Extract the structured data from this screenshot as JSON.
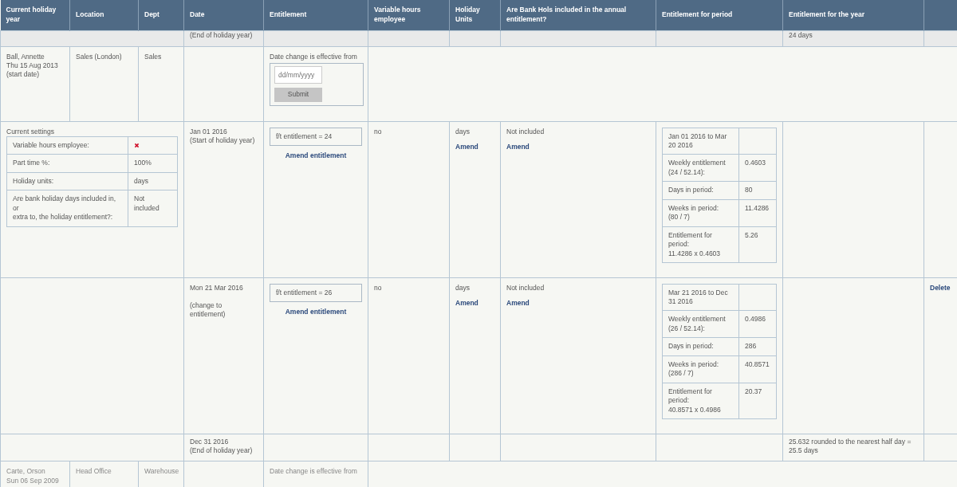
{
  "columns": [
    "Current holiday year",
    "Location",
    "Dept",
    "Date",
    "Entitlement",
    "Variable hours employee",
    "Holiday Units",
    "Are Bank Hols included in the annual entitlement?",
    "Entitlement for period",
    "Entitlement for the year"
  ],
  "rows": [
    {
      "kind": "year_end",
      "note": "(End of holiday year)",
      "year_total": "24 days"
    },
    {
      "kind": "employee",
      "name": "Ball, Annette",
      "start": "Thu 15 Aug 2013",
      "start_note": "(start date)",
      "location": "Sales (London)",
      "dept": "Sales",
      "date_form": {
        "label": "Date change is effective from",
        "placeholder": "dd/mm/yyyy",
        "button": "Submit"
      }
    },
    {
      "kind": "start",
      "settings": {
        "title": "Current settings",
        "items": [
          {
            "kind": "flag",
            "label": "Variable hours employee:",
            "checked": false
          },
          {
            "kind": "text",
            "label": "Part time %:",
            "value": "100%"
          },
          {
            "kind": "text",
            "label": "Holiday units:",
            "value": "days"
          },
          {
            "kind": "text",
            "label": "Are bank holiday days included in,\nor\nextra to, the holiday entitlement?:",
            "value": "Not\nincluded"
          }
        ]
      },
      "date": "Jan 01 2016",
      "note": "(Start of holiday year)",
      "entitlement": "f/t entitlement = 24",
      "entitlement_link": "Amend entitlement",
      "variable_hours": "no",
      "units": "days",
      "units_link": "Amend",
      "bank_hols": "Not included",
      "bank_hols_link": "Amend",
      "period": {
        "heading": "Jan 01 2016 to Mar\n20 2016",
        "lines": [
          {
            "label": "Weekly entitlement\n(24 / 52.14):",
            "value": "0.4603"
          },
          {
            "label": "Days in period:",
            "value": "80"
          },
          {
            "label": "Weeks in period:\n(80 / 7)",
            "value": "11.4286"
          },
          {
            "label": "Entitlement for\nperiod:\n11.4286 x 0.4603",
            "value": "5.26"
          }
        ]
      }
    },
    {
      "kind": "change",
      "date": "Mon 21 Mar 2016",
      "note": "(change to\nentitlement)",
      "entitlement": "f/t entitlement = 26",
      "entitlement_link": "Amend entitlement",
      "variable_hours": "no",
      "units": "days",
      "units_link": "Amend",
      "bank_hols": "Not included",
      "bank_hols_link": "Amend",
      "period": {
        "heading": "Mar 21 2016 to Dec\n31 2016",
        "lines": [
          {
            "label": "Weekly entitlement\n(26 / 52.14):",
            "value": "0.4986"
          },
          {
            "label": "Days in period:",
            "value": "286"
          },
          {
            "label": "Weeks in period:\n(286 / 7)",
            "value": "40.8571"
          },
          {
            "label": "Entitlement for\nperiod:\n40.8571 x 0.4986",
            "value": "20.37"
          }
        ]
      },
      "delete_link": "Delete"
    },
    {
      "kind": "year_end",
      "date": "Dec 31 2016",
      "note": "(End of holiday year)",
      "year_total": "25.632 rounded to the nearest half day =\n25.5 days"
    },
    {
      "kind": "employee",
      "name": "Carte, Orson",
      "start": "Sun 06 Sep 2009",
      "location": "Head Office",
      "dept": "Warehouse",
      "date_form": {
        "label": "Date change is effective from"
      }
    }
  ]
}
